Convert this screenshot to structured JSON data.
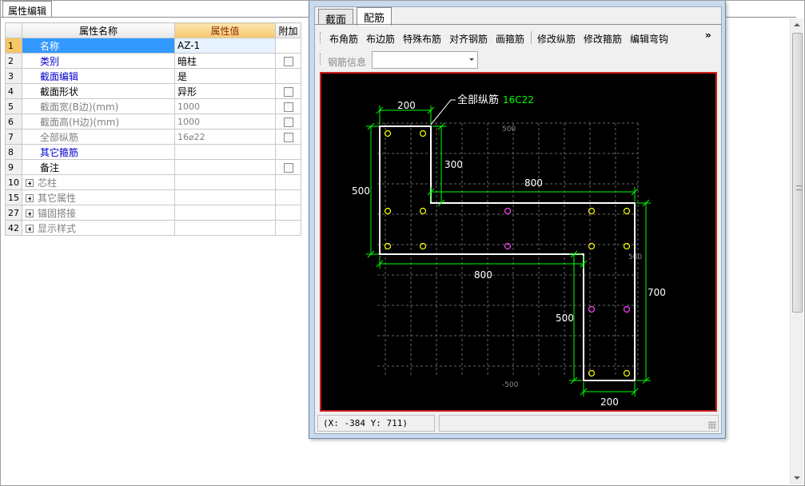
{
  "panel_tab": "属性编辑",
  "grid": {
    "headers": {
      "name": "属性名称",
      "value": "属性值",
      "extra": "附加"
    },
    "rows": [
      {
        "num": "1",
        "name": "名称",
        "value": "AZ-1"
      },
      {
        "num": "2",
        "name": "类别",
        "value": "暗柱"
      },
      {
        "num": "3",
        "name": "截面编辑",
        "value": "是"
      },
      {
        "num": "4",
        "name": "截面形状",
        "value": "异形"
      },
      {
        "num": "5",
        "name": "截面宽(B边)(mm)",
        "value": "1000"
      },
      {
        "num": "6",
        "name": "截面高(H边)(mm)",
        "value": "1000"
      },
      {
        "num": "7",
        "name": "全部纵筋",
        "value": "16⌀22"
      },
      {
        "num": "8",
        "name": "其它箍筋",
        "value": ""
      },
      {
        "num": "9",
        "name": "备注",
        "value": ""
      },
      {
        "num": "10",
        "name": "芯柱",
        "value": ""
      },
      {
        "num": "15",
        "name": "其它属性",
        "value": ""
      },
      {
        "num": "27",
        "name": "锚固搭接",
        "value": ""
      },
      {
        "num": "42",
        "name": "显示样式",
        "value": ""
      }
    ]
  },
  "dialog": {
    "tabs": [
      "截面",
      "配筋"
    ],
    "toolbar": [
      "布角筋",
      "布边筋",
      "特殊布筋",
      "对齐钢筋",
      "画箍筋",
      "修改纵筋",
      "修改箍筋",
      "编辑弯钩"
    ],
    "more": "»",
    "rebar_info_label": "钢筋信息",
    "rebar_info_value": "",
    "status_coords": "(X: -384 Y: 711)"
  },
  "drawing": {
    "leader_label": "全部纵筋",
    "leader_value": "16C22",
    "dims": {
      "top": "200",
      "inner_v": "300",
      "inner_h": "800",
      "left": "500",
      "mid_bottom": "800",
      "right": "700",
      "lower_left": "500",
      "bottom": "200"
    },
    "grid_labels": {
      "top": "500",
      "right": "500",
      "bottom": "-500"
    },
    "colors": {
      "outline": "#ffffff",
      "dim": "#00ff00",
      "bar_yellow": "#ffff00",
      "bar_magenta": "#ff40ff",
      "grid": "#8a8a8a",
      "leader_value": "#00ff00"
    }
  }
}
